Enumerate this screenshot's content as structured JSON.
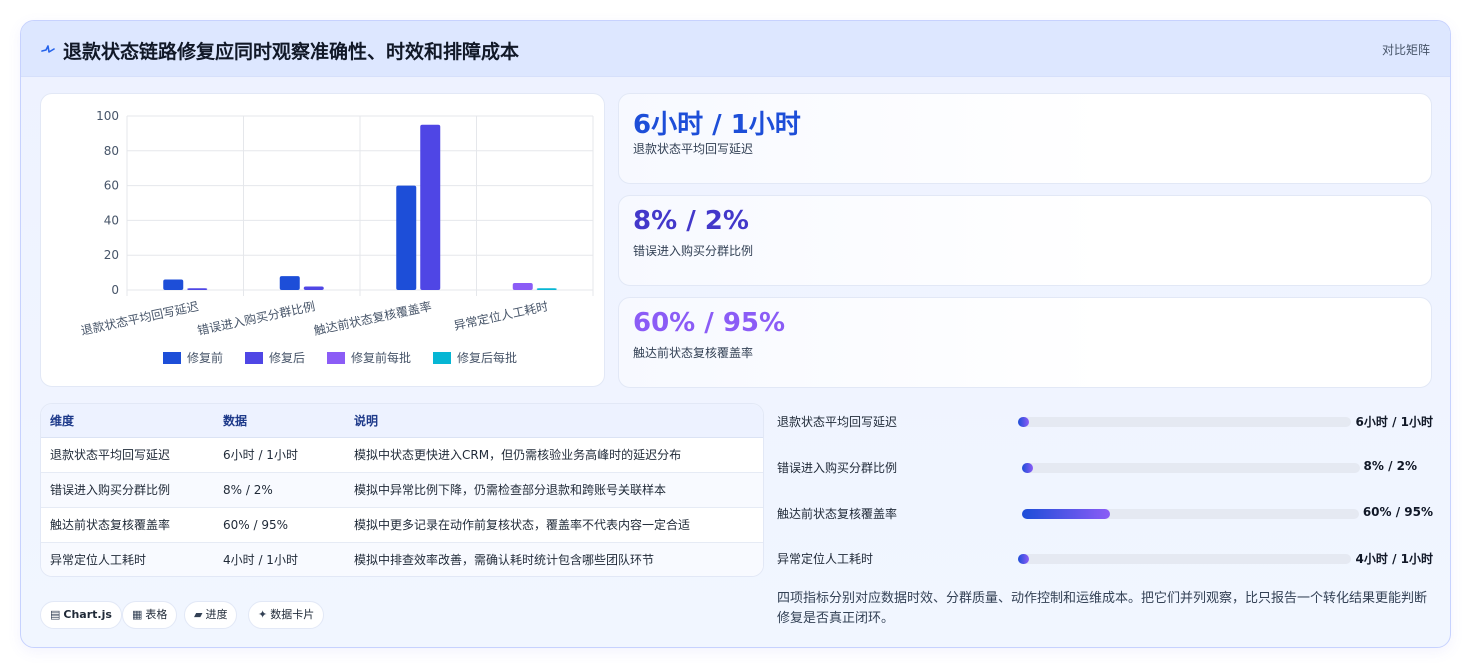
{
  "header": {
    "title": "退款状态链路修复应同时观察准确性、时效和排障成本",
    "tag": "对比矩阵",
    "accent": "#2563eb"
  },
  "chart_data": {
    "type": "bar",
    "categories": [
      "退款状态平均回写延迟",
      "错误进入购买分群比例",
      "触达前状态复核覆盖率",
      "异常定位人工耗时"
    ],
    "series": [
      {
        "name": "修复前",
        "values": [
          6,
          8,
          60,
          null
        ],
        "color": "#1d4ed8"
      },
      {
        "name": "修复后",
        "values": [
          1,
          2,
          95,
          null
        ],
        "color": "#4f46e5"
      },
      {
        "name": "修复前每批",
        "values": [
          null,
          null,
          null,
          4
        ],
        "color": "#8b5cf6"
      },
      {
        "name": "修复后每批",
        "values": [
          null,
          null,
          null,
          1
        ],
        "color": "#06b6d4"
      }
    ],
    "ylim": [
      0,
      100
    ],
    "yticks": [
      0,
      20,
      40,
      60,
      80,
      100
    ],
    "grid": true,
    "legend": "bottom"
  },
  "kpis": [
    {
      "value": "6小时 / 1小时",
      "label": "退款状态平均回写延迟",
      "color": "#1d4ed8"
    },
    {
      "value": "8% / 2%",
      "label": "错误进入购买分群比例",
      "color": "#4338ca"
    },
    {
      "value": "60% / 95%",
      "label": "触达前状态复核覆盖率",
      "color": "#8b5cf6"
    }
  ],
  "table": {
    "headers": [
      "维度",
      "数据",
      "说明"
    ],
    "rows": [
      [
        "退款状态平均回写延迟",
        "6小时 / 1小时",
        "模拟中状态更快进入CRM，但仍需核验业务高峰时的延迟分布"
      ],
      [
        "错误进入购买分群比例",
        "8% / 2%",
        "模拟中异常比例下降，仍需检查部分退款和跨账号关联样本"
      ],
      [
        "触达前状态复核覆盖率",
        "60% / 95%",
        "模拟中更多记录在动作前复核状态，覆盖率不代表内容一定合适"
      ],
      [
        "异常定位人工耗时",
        "4小时 / 1小时",
        "模拟中排查效率改善，需确认耗时统计包含哪些团队环节"
      ]
    ]
  },
  "progress": [
    {
      "label": "退款状态平均回写延迟",
      "value": "6小时 / 1小时",
      "fill": 0.02
    },
    {
      "label": "错误进入购买分群比例",
      "value": "8% / 2%",
      "fill": 0.02
    },
    {
      "label": "触达前状态复核覆盖率",
      "value": "60% / 95%",
      "fill": 0.26
    },
    {
      "label": "异常定位人工耗时",
      "value": "4小时 / 1小时",
      "fill": 0.02
    }
  ],
  "summary": "四项指标分别对应数据时效、分群质量、动作控制和运维成本。把它们并列观察，比只报告一个转化结果更能判断修复是否真正闭环。",
  "chips": [
    {
      "icon": "▤",
      "icon_name": "chart-icon",
      "label": "Chart.js"
    },
    {
      "icon": "▦",
      "icon_name": "table-icon",
      "label": "表格"
    },
    {
      "icon": "▰",
      "icon_name": "progress-icon",
      "label": "进度"
    },
    {
      "icon": "✦",
      "icon_name": "sparkle-icon",
      "label": "数据卡片"
    }
  ]
}
